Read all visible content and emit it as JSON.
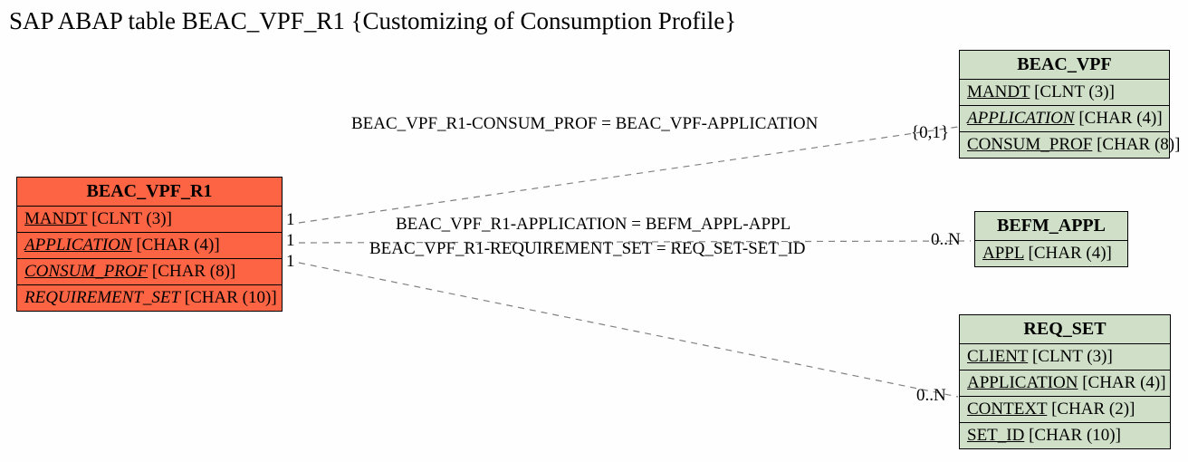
{
  "title": "SAP ABAP table BEAC_VPF_R1 {Customizing of Consumption Profile}",
  "entities": {
    "main": {
      "name": "BEAC_VPF_R1",
      "fields": [
        {
          "name": "MANDT",
          "type": "[CLNT (3)]",
          "ul": true,
          "it": false
        },
        {
          "name": "APPLICATION",
          "type": "[CHAR (4)]",
          "ul": true,
          "it": true
        },
        {
          "name": "CONSUM_PROF",
          "type": "[CHAR (8)]",
          "ul": true,
          "it": true
        },
        {
          "name": "REQUIREMENT_SET",
          "type": "[CHAR (10)]",
          "ul": false,
          "it": true
        }
      ]
    },
    "e1": {
      "name": "BEAC_VPF",
      "fields": [
        {
          "name": "MANDT",
          "type": "[CLNT (3)]",
          "ul": true,
          "it": false
        },
        {
          "name": "APPLICATION",
          "type": "[CHAR (4)]",
          "ul": true,
          "it": true
        },
        {
          "name": "CONSUM_PROF",
          "type": "[CHAR (8)]",
          "ul": true,
          "it": false
        }
      ]
    },
    "e2": {
      "name": "BEFM_APPL",
      "fields": [
        {
          "name": "APPL",
          "type": "[CHAR (4)]",
          "ul": true,
          "it": false
        }
      ]
    },
    "e3": {
      "name": "REQ_SET",
      "fields": [
        {
          "name": "CLIENT",
          "type": "[CLNT (3)]",
          "ul": true,
          "it": false
        },
        {
          "name": "APPLICATION",
          "type": "[CHAR (4)]",
          "ul": true,
          "it": false
        },
        {
          "name": "CONTEXT",
          "type": "[CHAR (2)]",
          "ul": true,
          "it": false
        },
        {
          "name": "SET_ID",
          "type": "[CHAR (10)]",
          "ul": true,
          "it": false
        }
      ]
    }
  },
  "relations": {
    "r1": {
      "text": "BEAC_VPF_R1-CONSUM_PROF = BEAC_VPF-APPLICATION",
      "leftCard": "1",
      "rightCard": "{0,1}"
    },
    "r2": {
      "text": "BEAC_VPF_R1-APPLICATION = BEFM_APPL-APPL",
      "leftCard": "1",
      "rightCard": "0..N"
    },
    "r3": {
      "text": "BEAC_VPF_R1-REQUIREMENT_SET = REQ_SET-SET_ID",
      "leftCard": "1",
      "rightCard": "0..N"
    }
  }
}
